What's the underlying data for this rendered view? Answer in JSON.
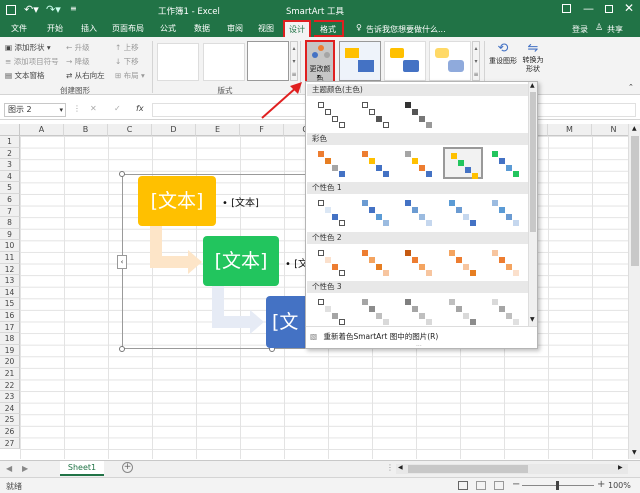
{
  "titlebar": {
    "doc_title": "工作簿1 - Excel",
    "context_title": "SmartArt 工具",
    "login": "登录",
    "share": "共享"
  },
  "tabs": [
    "文件",
    "开始",
    "插入",
    "页面布局",
    "公式",
    "数据",
    "审阅",
    "视图",
    "设计",
    "格式"
  ],
  "tell_me": "告诉我您想要做什么...",
  "ribbon": {
    "create_graphic": {
      "add_shape": "添加形状",
      "add_bullet": "添加项目符号",
      "text_pane": "文本窗格",
      "promote": "升级",
      "demote": "降级",
      "rtl": "从右向左",
      "move_up": "上移",
      "move_down": "下移",
      "layout": "布局",
      "group_label": "创建图形"
    },
    "layouts_label": "版式",
    "change_colors": "更改颜色",
    "reset_graphic": "重设图形",
    "convert_shape": "转换为形状"
  },
  "formula_bar": {
    "name_box": "图示 2",
    "fx": "fx"
  },
  "columns": [
    "A",
    "B",
    "C",
    "D",
    "E",
    "F",
    "G",
    "H",
    "I",
    "J",
    "K",
    "L",
    "M",
    "N"
  ],
  "rows": [
    "1",
    "2",
    "3",
    "4",
    "5",
    "6",
    "7",
    "8",
    "9",
    "10",
    "11",
    "12",
    "13",
    "14",
    "15",
    "16",
    "17",
    "18",
    "19",
    "20",
    "21",
    "22",
    "23",
    "24",
    "25",
    "26",
    "27"
  ],
  "smartart": {
    "card1": "[文本]",
    "card2": "[文本]",
    "card3": "[文",
    "bullet1": "• [文本]",
    "bullet2": "• [文"
  },
  "dropdown": {
    "sections": [
      "主题颜色(主色)",
      "彩色",
      "个性色 1",
      "个性色 2",
      "个性色 3"
    ],
    "footer": "重新着色SmartArt 图中的图片(R)",
    "palettes": {
      "theme": [
        [
          "#fff",
          "#fff",
          "#fff",
          "#fff"
        ],
        [
          "#fff",
          "#fff",
          "#555",
          "#fff"
        ],
        [
          "#333",
          "#555",
          "#777",
          "#999"
        ]
      ],
      "color": [
        [
          "#ed7d31",
          "#e67e22",
          "#a5a5a5",
          "#4472c4"
        ],
        [
          "#ed7d31",
          "#ffc000",
          "#4472c4",
          "#4472c4"
        ],
        [
          "#a5a5a5",
          "#ffc000",
          "#ed7d31",
          "#4472c4"
        ],
        [
          "#ffc000",
          "#22c55e",
          "#4472c4",
          "#ffc000"
        ],
        [
          "#22c55e",
          "#4472c4",
          "#5b9bd5",
          "#22c55e"
        ]
      ],
      "accent1": [
        [
          "#fff",
          "#dbe7f5",
          "#4472c4",
          "#fff"
        ],
        [
          "#6b9bd2",
          "#4472c4",
          "#5b9bd5",
          "#9bbbe0"
        ],
        [
          "#4472c4",
          "#6b9bd2",
          "#9bbbe0",
          "#c5d7ee"
        ],
        [
          "#5b9bd5",
          "#6b9bd2",
          "#c5d7ee",
          "#4472c4"
        ],
        [
          "#9bbbe0",
          "#5b9bd5",
          "#6b9bd2",
          "#c5d7ee"
        ]
      ],
      "accent2": [
        [
          "#fff",
          "#fbe0cc",
          "#ed7d31",
          "#fff"
        ],
        [
          "#ed7d31",
          "#f4a460",
          "#e67e22",
          "#f7c59f"
        ],
        [
          "#c55a11",
          "#ed7d31",
          "#f4a460",
          "#f7c59f"
        ],
        [
          "#f4a460",
          "#ed7d31",
          "#f7c59f",
          "#e67e22"
        ],
        [
          "#f7c59f",
          "#ed7d31",
          "#f4a460",
          "#fbe0cc"
        ]
      ],
      "accent3": [
        [
          "#fff",
          "#e0e0e0",
          "#a5a5a5",
          "#fff"
        ],
        [
          "#a5a5a5",
          "#8c8c8c",
          "#bfbfbf",
          "#d9d9d9"
        ],
        [
          "#7f7f7f",
          "#a5a5a5",
          "#bfbfbf",
          "#d9d9d9"
        ],
        [
          "#bfbfbf",
          "#a5a5a5",
          "#d9d9d9",
          "#8c8c8c"
        ],
        [
          "#d9d9d9",
          "#a5a5a5",
          "#bfbfbf",
          "#e0e0e0"
        ]
      ]
    }
  },
  "sheet_tab": "Sheet1",
  "status": {
    "ready": "就绪",
    "zoom": "100%"
  },
  "colors": {
    "excel_green": "#217346",
    "card1": "#ffc000",
    "card2": "#22c55e",
    "card3": "#4472c4",
    "highlight_red": "#e02020"
  }
}
